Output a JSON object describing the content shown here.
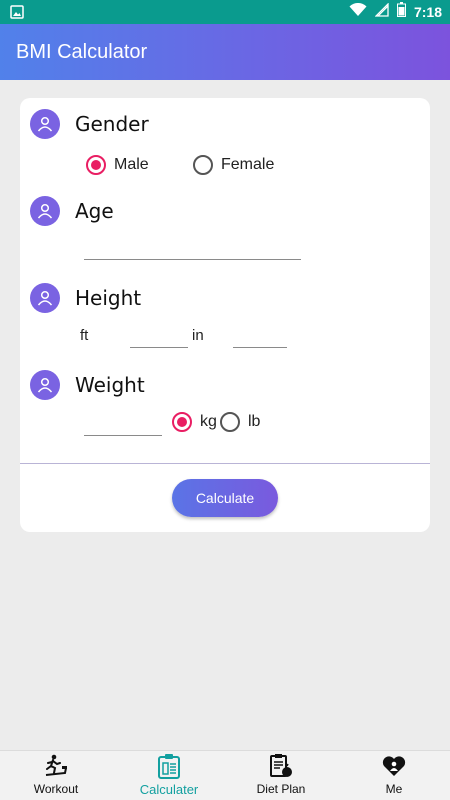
{
  "status_bar": {
    "time": "7:18"
  },
  "app_bar": {
    "title": "BMI Calculator"
  },
  "form": {
    "gender": {
      "label": "Gender",
      "options": [
        "Male",
        "Female"
      ],
      "selected": "Male"
    },
    "age": {
      "label": "Age",
      "value": ""
    },
    "height": {
      "label": "Height",
      "ft_unit": "ft",
      "in_unit": "in",
      "ft_value": "",
      "in_value": ""
    },
    "weight": {
      "label": "Weight",
      "value": "",
      "units": [
        "kg",
        "lb"
      ],
      "selected_unit": "kg"
    },
    "calculate_label": "Calculate"
  },
  "bottom_nav": {
    "items": [
      {
        "label": "Workout",
        "icon": "treadmill-icon"
      },
      {
        "label": "Calculater",
        "icon": "calculator-clipboard-icon",
        "active": true
      },
      {
        "label": "Diet Plan",
        "icon": "diet-clipboard-icon"
      },
      {
        "label": "Me",
        "icon": "heart-person-icon"
      }
    ]
  },
  "colors": {
    "accent": "#e91e63",
    "status_bar": "#0a9b8e",
    "gradient_start": "#5181ea",
    "gradient_end": "#7c53dd",
    "active_nav": "#13a0a0"
  }
}
